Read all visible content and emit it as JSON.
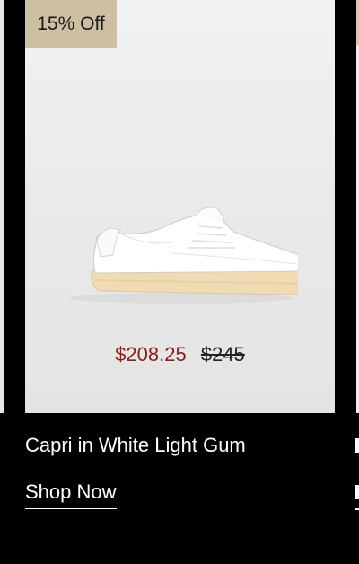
{
  "product": {
    "discount_badge": "15% Off",
    "sale_price": "$208.25",
    "original_price": "$245",
    "name": "Capri in White Light Gum",
    "cta_label": "Shop Now",
    "image_icon": "sneaker-image"
  },
  "colors": {
    "badge_bg": "#cdbfa2",
    "sale_price": "#8a1f1c",
    "page_bg": "#000000"
  }
}
